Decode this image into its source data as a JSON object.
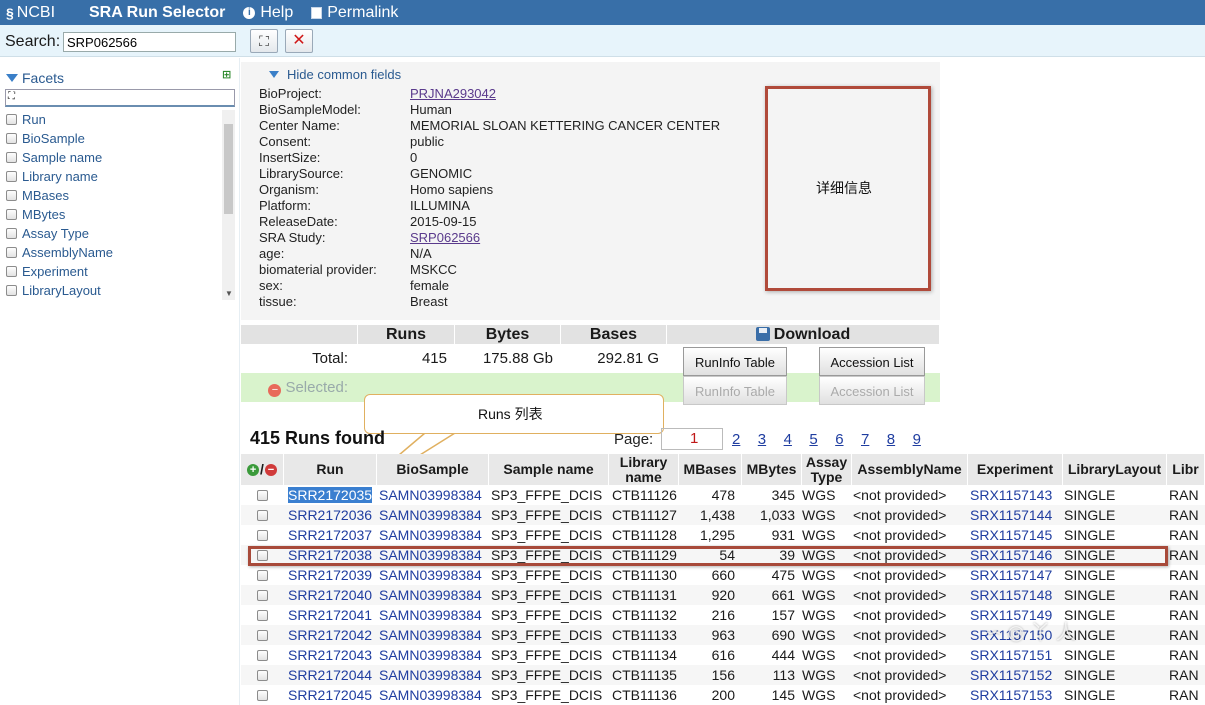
{
  "topbar": {
    "logo": "NCBI",
    "app_title": "SRA Run Selector",
    "help": "Help",
    "permalink": "Permalink"
  },
  "search": {
    "label": "Search:",
    "value": "SRP062566"
  },
  "facets": {
    "title": "Facets",
    "items": [
      "Run",
      "BioSample",
      "Sample name",
      "Library name",
      "MBases",
      "MBytes",
      "Assay Type",
      "AssemblyName",
      "Experiment",
      "LibraryLayout"
    ]
  },
  "common_fields": {
    "toggle_label": "Hide common fields",
    "rows": [
      {
        "key": "BioProject:",
        "value": "PRJNA293042",
        "link": true
      },
      {
        "key": "BioSampleModel:",
        "value": "Human"
      },
      {
        "key": "Center Name:",
        "value": "MEMORIAL SLOAN KETTERING CANCER CENTER"
      },
      {
        "key": "Consent:",
        "value": "public"
      },
      {
        "key": "InsertSize:",
        "value": "0"
      },
      {
        "key": "LibrarySource:",
        "value": "GENOMIC"
      },
      {
        "key": "Organism:",
        "value": "Homo sapiens"
      },
      {
        "key": "Platform:",
        "value": "ILLUMINA"
      },
      {
        "key": "ReleaseDate:",
        "value": "2015-09-15"
      },
      {
        "key": "SRA Study:",
        "value": "SRP062566",
        "link": true
      },
      {
        "key": "age:",
        "value": "N/A"
      },
      {
        "key": "biomaterial provider:",
        "value": "MSKCC"
      },
      {
        "key": "sex:",
        "value": "female"
      },
      {
        "key": "tissue:",
        "value": "Breast"
      }
    ]
  },
  "annotations": {
    "details": "详细信息",
    "runs_list": "Runs 列表"
  },
  "stats": {
    "headers": {
      "runs": "Runs",
      "bytes": "Bytes",
      "bases": "Bases",
      "download": "Download"
    },
    "total": {
      "label": "Total:",
      "runs": "415",
      "bytes": "175.88 Gb",
      "bases": "292.81 G"
    },
    "selected": {
      "label": "Selected:"
    },
    "buttons": {
      "runinfo": "RunInfo Table",
      "accession": "Accession List"
    }
  },
  "runs_found": "415 Runs found",
  "pager": {
    "label": "Page:",
    "current": "1",
    "pages": [
      "2",
      "3",
      "4",
      "5",
      "6",
      "7",
      "8",
      "9"
    ]
  },
  "runs_table": {
    "headers": [
      "Run",
      "BioSample",
      "Sample name",
      "Library name",
      "MBases",
      "MBytes",
      "Assay Type",
      "AssemblyName",
      "Experiment",
      "LibraryLayout",
      "Libr"
    ],
    "rows": [
      [
        "SRR2172035",
        "SAMN03998384",
        "SP3_FFPE_DCIS",
        "CTB11126",
        "478",
        "345",
        "WGS",
        "<not provided>",
        "SRX1157143",
        "SINGLE",
        "RAN"
      ],
      [
        "SRR2172036",
        "SAMN03998384",
        "SP3_FFPE_DCIS",
        "CTB11127",
        "1,438",
        "1,033",
        "WGS",
        "<not provided>",
        "SRX1157144",
        "SINGLE",
        "RAN"
      ],
      [
        "SRR2172037",
        "SAMN03998384",
        "SP3_FFPE_DCIS",
        "CTB11128",
        "1,295",
        "931",
        "WGS",
        "<not provided>",
        "SRX1157145",
        "SINGLE",
        "RAN"
      ],
      [
        "SRR2172038",
        "SAMN03998384",
        "SP3_FFPE_DCIS",
        "CTB11129",
        "54",
        "39",
        "WGS",
        "<not provided>",
        "SRX1157146",
        "SINGLE",
        "RAN"
      ],
      [
        "SRR2172039",
        "SAMN03998384",
        "SP3_FFPE_DCIS",
        "CTB11130",
        "660",
        "475",
        "WGS",
        "<not provided>",
        "SRX1157147",
        "SINGLE",
        "RAN"
      ],
      [
        "SRR2172040",
        "SAMN03998384",
        "SP3_FFPE_DCIS",
        "CTB11131",
        "920",
        "661",
        "WGS",
        "<not provided>",
        "SRX1157148",
        "SINGLE",
        "RAN"
      ],
      [
        "SRR2172041",
        "SAMN03998384",
        "SP3_FFPE_DCIS",
        "CTB11132",
        "216",
        "157",
        "WGS",
        "<not provided>",
        "SRX1157149",
        "SINGLE",
        "RAN"
      ],
      [
        "SRR2172042",
        "SAMN03998384",
        "SP3_FFPE_DCIS",
        "CTB11133",
        "963",
        "690",
        "WGS",
        "<not provided>",
        "SRX1157150",
        "SINGLE",
        "RAN"
      ],
      [
        "SRR2172043",
        "SAMN03998384",
        "SP3_FFPE_DCIS",
        "CTB11134",
        "616",
        "444",
        "WGS",
        "<not provided>",
        "SRX1157151",
        "SINGLE",
        "RAN"
      ],
      [
        "SRR2172044",
        "SAMN03998384",
        "SP3_FFPE_DCIS",
        "CTB11135",
        "156",
        "113",
        "WGS",
        "<not provided>",
        "SRX1157152",
        "SINGLE",
        "RAN"
      ],
      [
        "SRR2172045",
        "SAMN03998384",
        "SP3_FFPE_DCIS",
        "CTB11136",
        "200",
        "145",
        "WGS",
        "<not provided>",
        "SRX1157153",
        "SINGLE",
        "RAN"
      ]
    ]
  },
  "colors": {
    "topbar": "#386fa8",
    "link": "#1f3da0",
    "annotation_border": "#b04a3a",
    "selected_row_bg": "#d9f3cc"
  }
}
